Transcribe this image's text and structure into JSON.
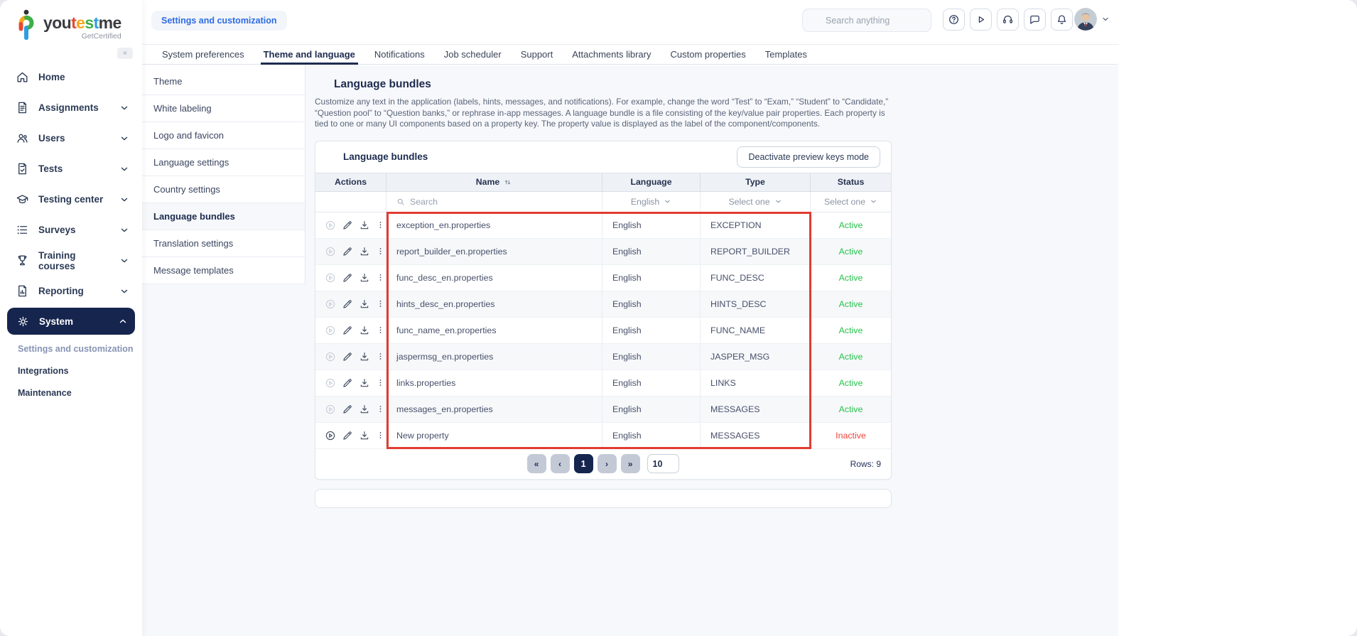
{
  "sidebar": {
    "logo": {
      "segments": [
        {
          "text": "you",
          "color": "#3b3b40"
        },
        {
          "text": "t",
          "color": "#e8482f"
        },
        {
          "text": "e",
          "color": "#f5a81c"
        },
        {
          "text": "s",
          "color": "#3fae49"
        },
        {
          "text": "t",
          "color": "#2d9fe0"
        },
        {
          "text": "me",
          "color": "#3b3b40"
        }
      ],
      "tagline": "GetCertified"
    },
    "collapse_label": "«",
    "items": [
      {
        "label": "Home",
        "icon": "home-icon",
        "chevron": null,
        "active": false
      },
      {
        "label": "Assignments",
        "icon": "assignments-icon",
        "chevron": "down",
        "active": false
      },
      {
        "label": "Users",
        "icon": "users-icon",
        "chevron": "down",
        "active": false
      },
      {
        "label": "Tests",
        "icon": "tests-icon",
        "chevron": "down",
        "active": false
      },
      {
        "label": "Testing center",
        "icon": "testing-center-icon",
        "chevron": "down",
        "active": false
      },
      {
        "label": "Surveys",
        "icon": "surveys-icon",
        "chevron": "down",
        "active": false
      },
      {
        "label": "Training courses",
        "icon": "training-courses-icon",
        "chevron": "down",
        "active": false
      },
      {
        "label": "Reporting",
        "icon": "reporting-icon",
        "chevron": "down",
        "active": false
      },
      {
        "label": "System",
        "icon": "system-gear-icon",
        "chevron": "up",
        "active": true
      }
    ],
    "system_subitems": [
      {
        "label": "Settings and customization",
        "active": true
      },
      {
        "label": "Integrations",
        "active": false
      },
      {
        "label": "Maintenance",
        "active": false
      }
    ]
  },
  "topbar": {
    "breadcrumb": "Settings and customization",
    "search_placeholder": "Search anything",
    "icon_buttons": [
      "help-icon",
      "walkthrough-play-icon",
      "support-headset-icon",
      "chat-icon",
      "notifications-bell-icon"
    ]
  },
  "tabs": {
    "items": [
      "System preferences",
      "Theme and language",
      "Notifications",
      "Job scheduler",
      "Support",
      "Attachments library",
      "Custom properties",
      "Templates"
    ],
    "active": "Theme and language"
  },
  "settings_menu": {
    "items": [
      "Theme",
      "White labeling",
      "Logo and favicon",
      "Language settings",
      "Country settings",
      "Language bundles",
      "Translation settings",
      "Message templates"
    ],
    "active": "Language bundles"
  },
  "page": {
    "title": "Language bundles",
    "description": "Customize any text in the application (labels, hints, messages, and notifications). For example, change the word “Test” to “Exam,” “Student” to “Candidate,” “Question pool” to “Question banks,” or rephrase in-app messages. A language bundle is a file consisting of the key/value pair properties. Each property is tied to one or many UI components based on a property key. The property value is displayed as the label of the component/components."
  },
  "panel": {
    "title": "Language bundles",
    "action_button": "Deactivate preview keys mode"
  },
  "table": {
    "columns": [
      "Actions",
      "Name",
      "Language",
      "Type",
      "Status"
    ],
    "sort_column": "Name",
    "filters": {
      "name_placeholder": "Search",
      "language": "English",
      "type": "Select one",
      "status": "Select one"
    },
    "row_actions": [
      "play-icon",
      "edit-pencil-icon",
      "download-icon",
      "kebab-menu-icon"
    ],
    "rows": [
      {
        "name": "exception_en.properties",
        "language": "English",
        "type": "EXCEPTION",
        "status": "Active",
        "play_enabled": false
      },
      {
        "name": "report_builder_en.properties",
        "language": "English",
        "type": "REPORT_BUILDER",
        "status": "Active",
        "play_enabled": false
      },
      {
        "name": "func_desc_en.properties",
        "language": "English",
        "type": "FUNC_DESC",
        "status": "Active",
        "play_enabled": false
      },
      {
        "name": "hints_desc_en.properties",
        "language": "English",
        "type": "HINTS_DESC",
        "status": "Active",
        "play_enabled": false
      },
      {
        "name": "func_name_en.properties",
        "language": "English",
        "type": "FUNC_NAME",
        "status": "Active",
        "play_enabled": false
      },
      {
        "name": "jaspermsg_en.properties",
        "language": "English",
        "type": "JASPER_MSG",
        "status": "Active",
        "play_enabled": false
      },
      {
        "name": "links.properties",
        "language": "English",
        "type": "LINKS",
        "status": "Active",
        "play_enabled": false
      },
      {
        "name": "messages_en.properties",
        "language": "English",
        "type": "MESSAGES",
        "status": "Active",
        "play_enabled": false
      },
      {
        "name": "New property",
        "language": "English",
        "type": "MESSAGES",
        "status": "Inactive",
        "play_enabled": true
      }
    ],
    "status_colors": {
      "Active": "#27c24c",
      "Inactive": "#f0443b"
    }
  },
  "pagination": {
    "first": "«",
    "prev": "‹",
    "active_page": "1",
    "next": "›",
    "last": "»",
    "page_size": "10",
    "rows_label": "Rows: 9"
  },
  "highlight_color": "#e23c32"
}
